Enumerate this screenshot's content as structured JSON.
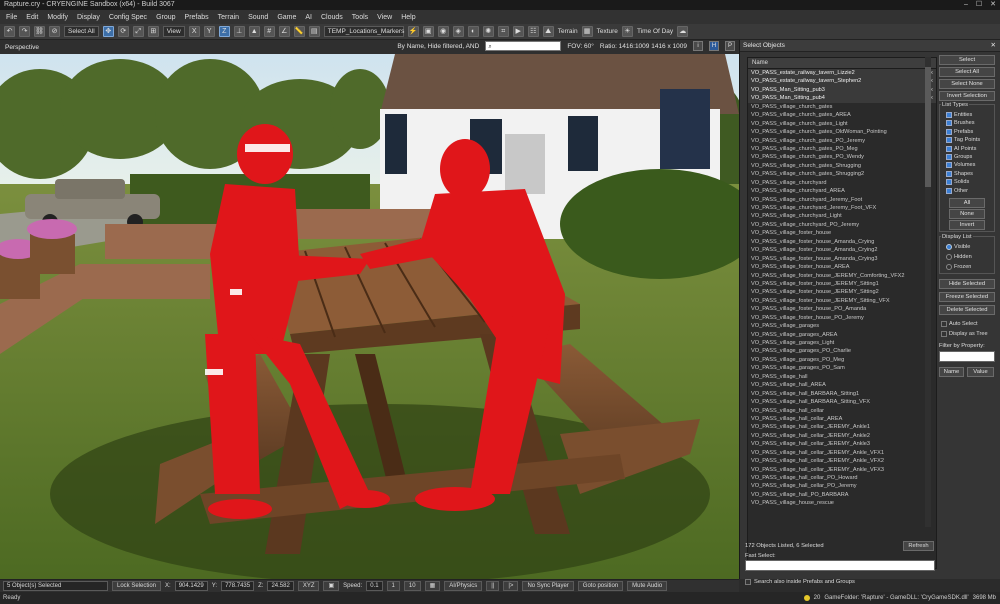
{
  "window": {
    "title": "Rapture.cry - CRYENGINE Sandbox (x64) - Build 3067",
    "min": "–",
    "max": "☐",
    "close": "✕"
  },
  "menu": [
    "File",
    "Edit",
    "Modify",
    "Display",
    "Config Spec",
    "Group",
    "Prefabs",
    "Terrain",
    "Sound",
    "Game",
    "AI",
    "Clouds",
    "Tools",
    "View",
    "Help"
  ],
  "toolbar": {
    "select_all": "Select All",
    "view_select": "View",
    "locations": "TEMP_Locations_Markers",
    "terrain": "Terrain",
    "texture": "Texture",
    "time_of_day": "Time Of Day"
  },
  "viewport_header": {
    "title": "Perspective",
    "filter": "By Name, Hide filtered, AND",
    "search": "",
    "fov": "FOV:   60°",
    "ratio": "Ratio: 1416:1009   1416 x 1009",
    "btn_i": "i",
    "btn_h": "H",
    "btn_p": "P"
  },
  "select_panel": {
    "title": "Select Objects",
    "close": "✕",
    "column_header": "Name",
    "objects": [
      "VO_PASS_estate_railway_tavern_Lizzie2",
      "VO_PASS_estate_railway_tavern_Stephen2",
      "VO_PASS_Man_Sitting_pub3",
      "VO_PASS_Man_Sitting_pub4",
      "VO_PASS_village_church_gates",
      "VO_PASS_village_church_gates_AREA",
      "VO_PASS_village_church_gates_Light",
      "VO_PASS_village_church_gates_OldWoman_Pointing",
      "VO_PASS_village_church_gates_PO_Jeremy",
      "VO_PASS_village_church_gates_PO_Meg",
      "VO_PASS_village_church_gates_PO_Wendy",
      "VO_PASS_village_church_gates_Shrugging",
      "VO_PASS_village_church_gates_Shrugging2",
      "VO_PASS_village_churchyard",
      "VO_PASS_village_churchyard_AREA",
      "VO_PASS_village_churchyard_Jeremy_Foot",
      "VO_PASS_village_churchyard_Jeremy_Foot_VFX",
      "VO_PASS_village_churchyard_Light",
      "VO_PASS_village_churchyard_PO_Jeremy",
      "VO_PASS_village_foster_house",
      "VO_PASS_village_foster_house_Amanda_Crying",
      "VO_PASS_village_foster_house_Amanda_Crying2",
      "VO_PASS_village_foster_house_Amanda_Crying3",
      "VO_PASS_village_foster_house_AREA",
      "VO_PASS_village_foster_house_JEREMY_Comforting_VFX2",
      "VO_PASS_village_foster_house_JEREMY_Sitting1",
      "VO_PASS_village_foster_house_JEREMY_Sitting2",
      "VO_PASS_village_foster_house_JEREMY_Sitting_VFX",
      "VO_PASS_village_foster_house_PO_Amanda",
      "VO_PASS_village_foster_house_PO_Jeremy",
      "VO_PASS_village_garages",
      "VO_PASS_village_garages_AREA",
      "VO_PASS_village_garages_Light",
      "VO_PASS_village_garages_PO_Charlie",
      "VO_PASS_village_garages_PO_Meg",
      "VO_PASS_village_garages_PO_Sam",
      "VO_PASS_village_hall",
      "VO_PASS_village_hall_AREA",
      "VO_PASS_village_hall_BARBARA_Sitting1",
      "VO_PASS_village_hall_BARBARA_Sitting_VFX",
      "VO_PASS_village_hall_cellar",
      "VO_PASS_village_hall_cellar_AREA",
      "VO_PASS_village_hall_cellar_JEREMY_Ankle1",
      "VO_PASS_village_hall_cellar_JEREMY_Ankle2",
      "VO_PASS_village_hall_cellar_JEREMY_Ankle3",
      "VO_PASS_village_hall_cellar_JEREMY_Ankle_VFX1",
      "VO_PASS_village_hall_cellar_JEREMY_Ankle_VFX2",
      "VO_PASS_village_hall_cellar_JEREMY_Ankle_VFX3",
      "VO_PASS_village_hall_cellar_PO_Howard",
      "VO_PASS_village_hall_cellar_PO_Jeremy",
      "VO_PASS_village_hall_PO_BARBARA",
      "VO_PASS_village_house_rescue"
    ],
    "selected_marks": "x",
    "buttons": {
      "select": "Select",
      "select_all": "Select All",
      "select_none": "Select None",
      "invert_selection": "Invert Selection",
      "all": "All",
      "none": "None",
      "invert": "Invert",
      "hide_selected": "Hide Selected",
      "freeze_selected": "Freeze Selected",
      "delete_selected": "Delete Selected",
      "name": "Name",
      "value": "Value",
      "refresh": "Refresh"
    },
    "list_types_label": "List Types",
    "list_types": [
      "Entities",
      "Brushes",
      "Prefabs",
      "Tag Points",
      "AI Points",
      "Groups",
      "Volumes",
      "Shapes",
      "Solids",
      "Other"
    ],
    "display_list_label": "Display List",
    "display_list": [
      "Visible",
      "Hidden",
      "Frozen"
    ],
    "auto_select": "Auto Select",
    "display_as_tree": "Display as Tree",
    "filter_by_property": "Filter by Property:",
    "count": "172 Objects Listed,  6 Selected",
    "fast_select_label": "Fast Select:",
    "search_also_inside": "Search also inside Prefabs and Groups"
  },
  "statusbar": {
    "selection": "5 Object(s) Selected",
    "lock_selection": "Lock Selection",
    "x_label": "X:",
    "x": "904.1429",
    "y_label": "Y:",
    "y": "778.7435",
    "z_label": "Z:",
    "z": "24.582",
    "xyz": "XYZ",
    "speed_label": "Speed:",
    "speed": "0.1",
    "s1": "1",
    "s10": "10",
    "ai_physics": "AI/Physics",
    "pause": "||",
    "step": "|>",
    "no_sync": "No Sync Player",
    "goto": "Goto position",
    "mute": "Mute Audio"
  },
  "footer": {
    "ready": "Ready",
    "fps": "20",
    "game_info": "GameFolder: 'Rapture' - GameDLL: 'CryGameSDK.dll'",
    "memory": "3698 Mb"
  }
}
